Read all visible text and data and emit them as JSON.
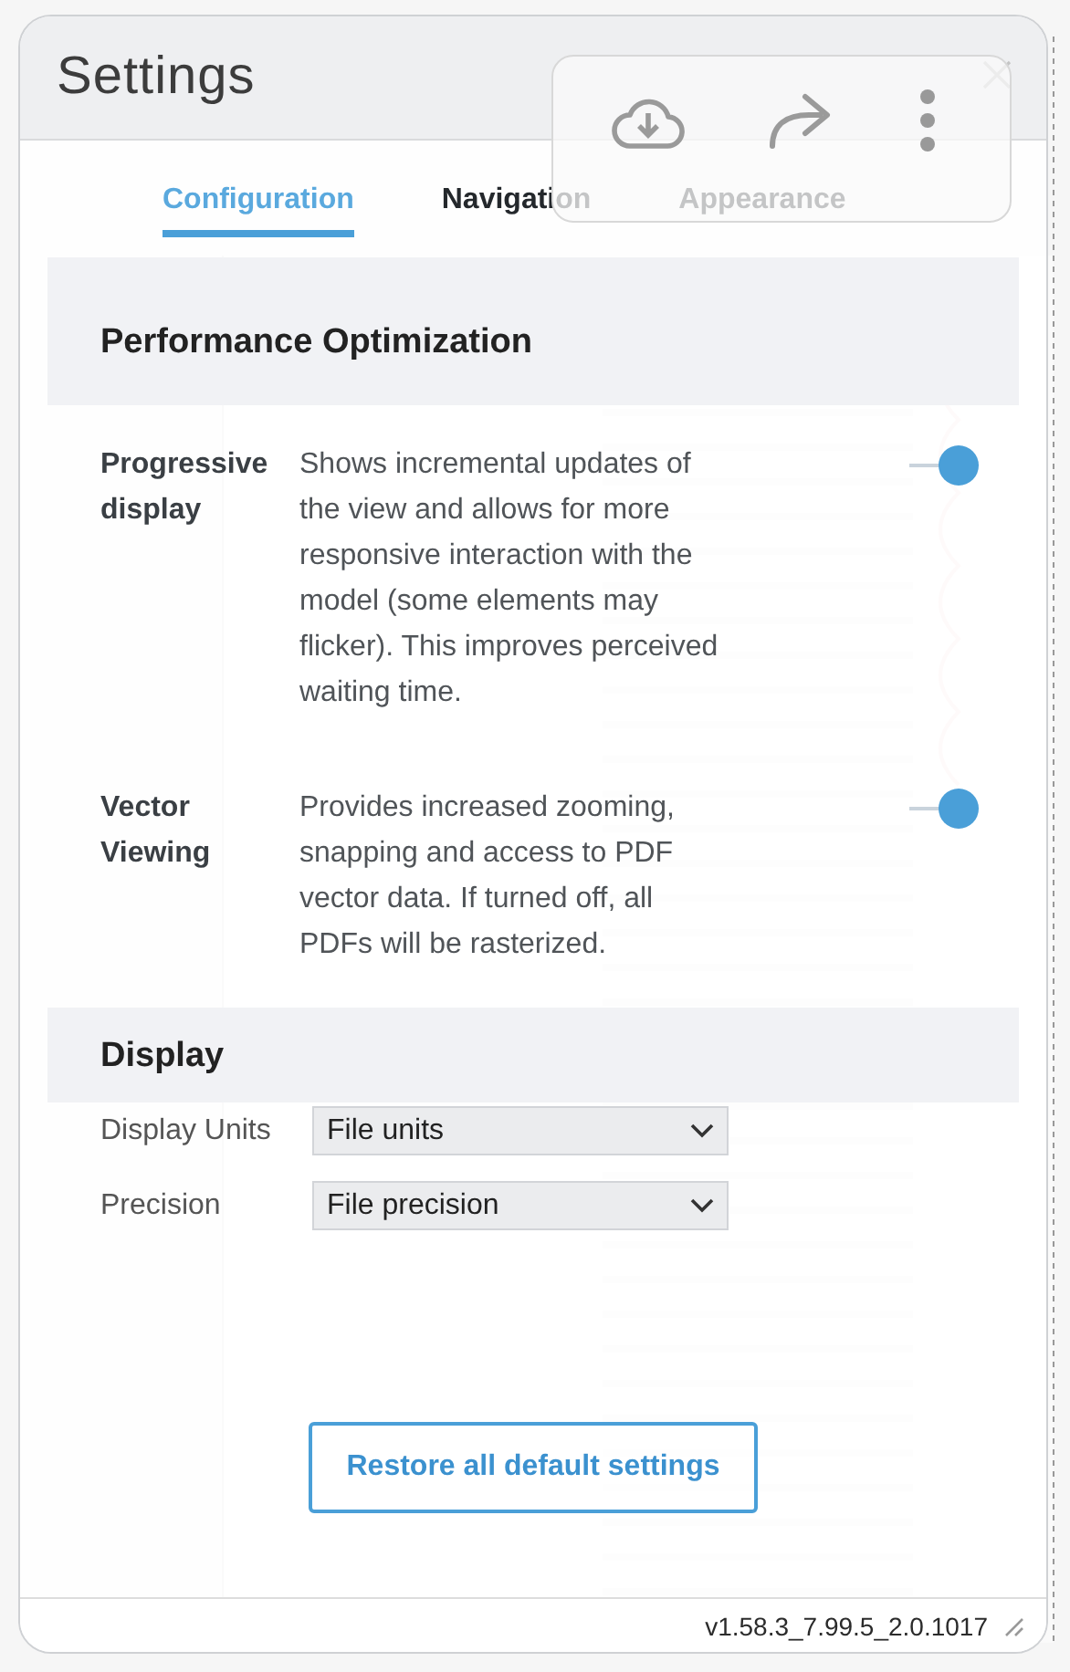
{
  "title": "Settings",
  "tabs": [
    {
      "label": "Configuration",
      "selected": true
    },
    {
      "label": "Navigation",
      "selected": false
    },
    {
      "label": "Appearance",
      "selected": false
    }
  ],
  "sections": [
    {
      "title": "Performance Optimization",
      "rows": [
        {
          "kind": "toggle",
          "label": "Progressive display",
          "description": "Shows incremental updates of the view and allows for more responsive interaction with the model (some elements may flicker). This improves perceived waiting time.",
          "on": true
        },
        {
          "kind": "toggle",
          "label": "Vector Viewing",
          "description": "Provides increased zooming, snapping and access to PDF vector data. If turned off, all PDFs will be rasterized.",
          "on": true
        }
      ]
    },
    {
      "title": "Display",
      "rows": [
        {
          "kind": "select",
          "label": "Display Units",
          "value": "File units"
        },
        {
          "kind": "select",
          "label": "Precision",
          "value": "File precision"
        }
      ]
    }
  ],
  "restore_button": "Restore all default settings",
  "version": "v1.58.3_7.99.5_2.0.1017"
}
